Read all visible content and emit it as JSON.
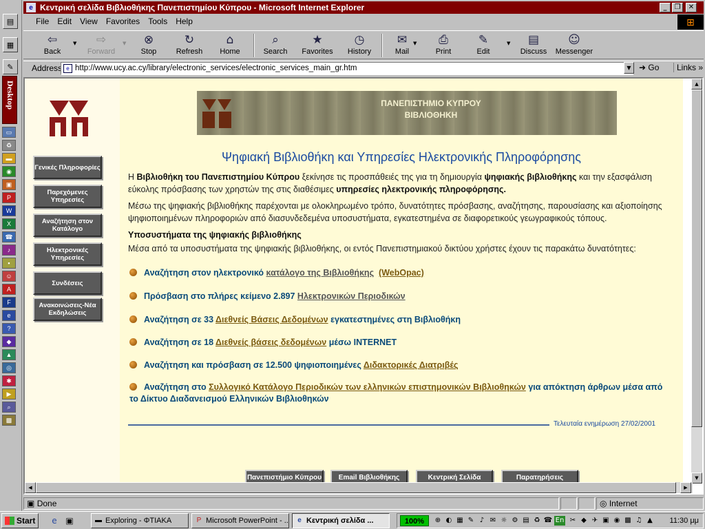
{
  "window": {
    "title": "Κεντρική σελίδα Βιβλιοθήκης Πανεπιστημίου Κύπρου - Microsoft Internet Explorer"
  },
  "menu": [
    "File",
    "Edit",
    "View",
    "Favorites",
    "Tools",
    "Help"
  ],
  "toolbar": {
    "back": "Back",
    "forward": "Forward",
    "stop": "Stop",
    "refresh": "Refresh",
    "home": "Home",
    "search": "Search",
    "favorites": "Favorites",
    "history": "History",
    "mail": "Mail",
    "print": "Print",
    "edit": "Edit",
    "discuss": "Discuss",
    "messenger": "Messenger"
  },
  "address": {
    "label": "Address",
    "url": "http://www.ucy.ac.cy/library/electronic_services/electronic_services_main_gr.htm",
    "go": "Go",
    "links": "Links"
  },
  "office_bar": {
    "desktop": "Desktop"
  },
  "nav": [
    "Γενικές Πληροφορίες",
    "Παρεχόμενες Υπηρεσίες",
    "Αναζήτηση στον Κατάλογο",
    "Ηλεκτρονικές Υπηρεσίες",
    "Συνδέσεις",
    "Ανακοινώσεις-Νέα Εκδηλώσεις"
  ],
  "banner": {
    "line1": "ΠΑΝΕΠΙΣΤΗΜΙΟ ΚΥΠΡΟΥ",
    "line2": "ΒΙΒΛΙΟΘΗΚΗ"
  },
  "content": {
    "heading": "Ψηφιακή Βιβλιοθήκη και Υπηρεσίες Ηλεκτρονικής Πληροφόρησης",
    "p1_a": "Η ",
    "p1_b": "Βιβλιοθήκη του Πανεπιστημίου Κύπρου",
    "p1_c": " ξεκίνησε τις προσπάθειές της για τη δημιουργία ",
    "p1_d": "ψηφιακής βιβλιοθήκης",
    "p1_e": " και την εξασφάλιση εύκολης πρόσβασης των χρηστών της στις διαθέσιμες ",
    "p1_f": "υπηρεσίες ηλεκτρονικής πληροφόρησης.",
    "p2": "Μέσω της ψηφιακής βιβλιοθήκης παρέχονται με ολοκληρωμένο τρόπο, δυνατότητες πρόσβασης, αναζήτησης, παρουσίασης και αξιοποίησης ψηφιοποιημένων πληροφοριών από διασυνδεδεμένα υποσυστήματα, εγκατεστημένα σε διαφορετικούς γεωγραφικούς τόπους.",
    "subheading": "Υποσυστήματα της ψηφιακής βιβλιοθήκης",
    "intro": "Μέσα από τα υποσυστήματα της ψηφιακής βιβλιοθήκης, οι εντός Πανεπιστημιακού δικτύου χρήστες έχουν τις παρακάτω δυνατότητες:",
    "s1_text": "Αναζήτηση στον ηλεκτρονικό ",
    "s1_link": "κατάλογο της Βιβλιοθήκης",
    "s1_link2": "(WebOpac)",
    "s2_text": "Πρόσβαση στο πλήρες κείμενο 2.897 ",
    "s2_link": "Ηλεκτρονικών Περιοδικών",
    "s3_text": "Αναζήτηση σε 33 ",
    "s3_link": "Διεθνείς Βάσεις Δεδομένων",
    "s3_tail": " εγκατεστημένες στη Βιβλιοθήκη",
    "s4_text": "Αναζήτηση σε 18 ",
    "s4_link": "Διεθνείς βάσεις δεδομένων",
    "s4_tail": " μέσω INTERNET",
    "s5_text": "Αναζήτηση και πρόσβαση σε 12.500 ψηφιοποιημένες ",
    "s5_link": "Διδακτορικές Διατριβές",
    "s6_text": "Αναζήτηση στο ",
    "s6_link": "Συλλογικό Κατάλογο Περιοδικών των ελληνικών επιστημονικών Βιβλιοθηκών",
    "s6_tail": " για απόκτηση άρθρων μέσα από το Δίκτυο Διαδανεισμού Ελληνικών Βιβλιοθηκών",
    "updated": "Τελευταία ενημέρωση 27/02/2001"
  },
  "footer_buttons": [
    "Πανεπιστήμιο Κύπρου",
    "Email Βιβλιοθήκης",
    "Κεντρική Σελίδα",
    "Παρατηρήσεις"
  ],
  "status": {
    "text": "Done",
    "zone": "Internet"
  },
  "taskbar": {
    "start": "Start",
    "tasks": [
      "Exploring - ΦΤΙΑΚΑ",
      "Microsoft PowerPoint - ...",
      "Κεντρική σελίδα ..."
    ],
    "zoom": "100%",
    "lang": "En",
    "clock": "11:30 μμ"
  }
}
